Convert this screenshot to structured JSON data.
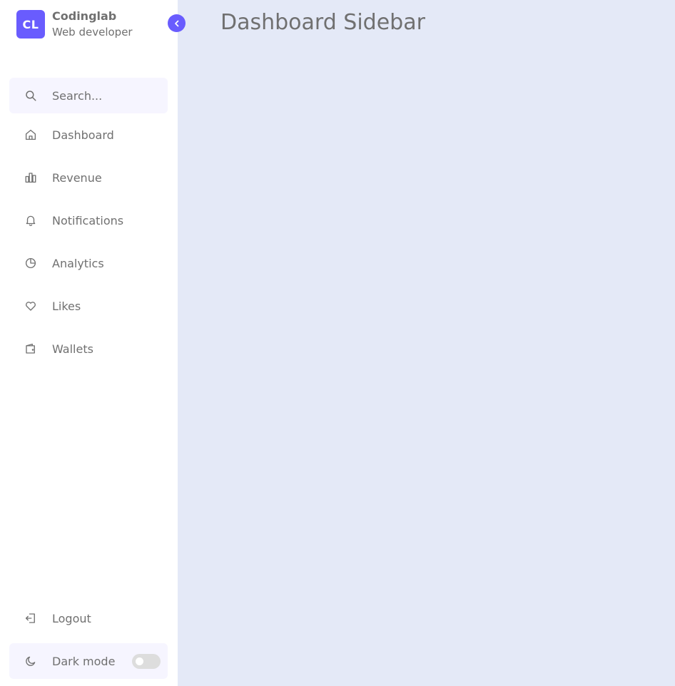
{
  "brand": {
    "logo_text": "CL",
    "name": "Codinglab",
    "role": "Web developer"
  },
  "sidebar_toggle": {
    "icon": "chevron-left-icon"
  },
  "search": {
    "placeholder": "Search...",
    "value": "",
    "icon": "search-icon"
  },
  "menu": {
    "items": [
      {
        "label": "Dashboard",
        "icon": "home-icon"
      },
      {
        "label": "Revenue",
        "icon": "bar-chart-icon"
      },
      {
        "label": "Notifications",
        "icon": "bell-icon"
      },
      {
        "label": "Analytics",
        "icon": "pie-chart-icon"
      },
      {
        "label": "Likes",
        "icon": "heart-icon"
      },
      {
        "label": "Wallets",
        "icon": "wallet-icon"
      }
    ]
  },
  "bottom": {
    "logout_label": "Logout",
    "dark_mode_label": "Dark mode",
    "dark_mode_on": false
  },
  "main": {
    "title": "Dashboard Sidebar"
  },
  "colors": {
    "accent": "#695cfe",
    "sidebar_bg": "#ffffff",
    "page_bg": "#e4e9f7",
    "search_bg": "#f6f5ff",
    "text": "#707070",
    "switch_track": "#dddddd"
  }
}
